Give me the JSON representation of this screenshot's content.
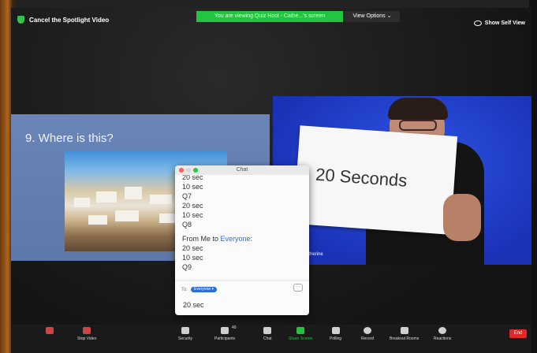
{
  "top_bar": {
    "cancel_spotlight": "Cancel the Spotlight Video",
    "viewing_banner": "You are viewing Quiz Host - Cathe...'s screen",
    "view_options": "View Options ⌄",
    "show_self_view": "Show Self View"
  },
  "slide": {
    "title": "9. Where is this?"
  },
  "video": {
    "sign_text": "20 Seconds",
    "participant_name": "- Catherine"
  },
  "chat": {
    "window_title": "Chat",
    "messages_before": [
      "20 sec",
      "10 sec",
      "Q7",
      "20 sec",
      "10 sec",
      "Q8"
    ],
    "from_prefix": "From Me to ",
    "from_target": "Everyone",
    "from_suffix": ":",
    "messages_after": [
      "20 sec",
      "10 sec",
      "Q9"
    ],
    "to_label": "To:",
    "to_value": "Everyone ▾",
    "more_label": "···",
    "input_value": "20 sec"
  },
  "toolbar": {
    "buttons": [
      {
        "label": "",
        "icon": "mute-icon"
      },
      {
        "label": "Stop Video",
        "icon": "video-off-icon"
      },
      {
        "label": "Security",
        "icon": "shield-icon"
      },
      {
        "label": "Participants",
        "icon": "participants-icon",
        "count": "49"
      },
      {
        "label": "Chat",
        "icon": "chat-icon"
      },
      {
        "label": "Share Screen",
        "icon": "share-screen-icon"
      },
      {
        "label": "Polling",
        "icon": "polling-icon"
      },
      {
        "label": "Record",
        "icon": "record-icon"
      },
      {
        "label": "Breakout Rooms",
        "icon": "breakout-rooms-icon"
      },
      {
        "label": "Reactions",
        "icon": "reactions-icon"
      }
    ],
    "end_label": "End"
  },
  "colors": {
    "banner_green": "#22c53f",
    "video_blue": "#1f3fd0",
    "chat_link_blue": "#2b6cd8",
    "end_red": "#e02828"
  }
}
